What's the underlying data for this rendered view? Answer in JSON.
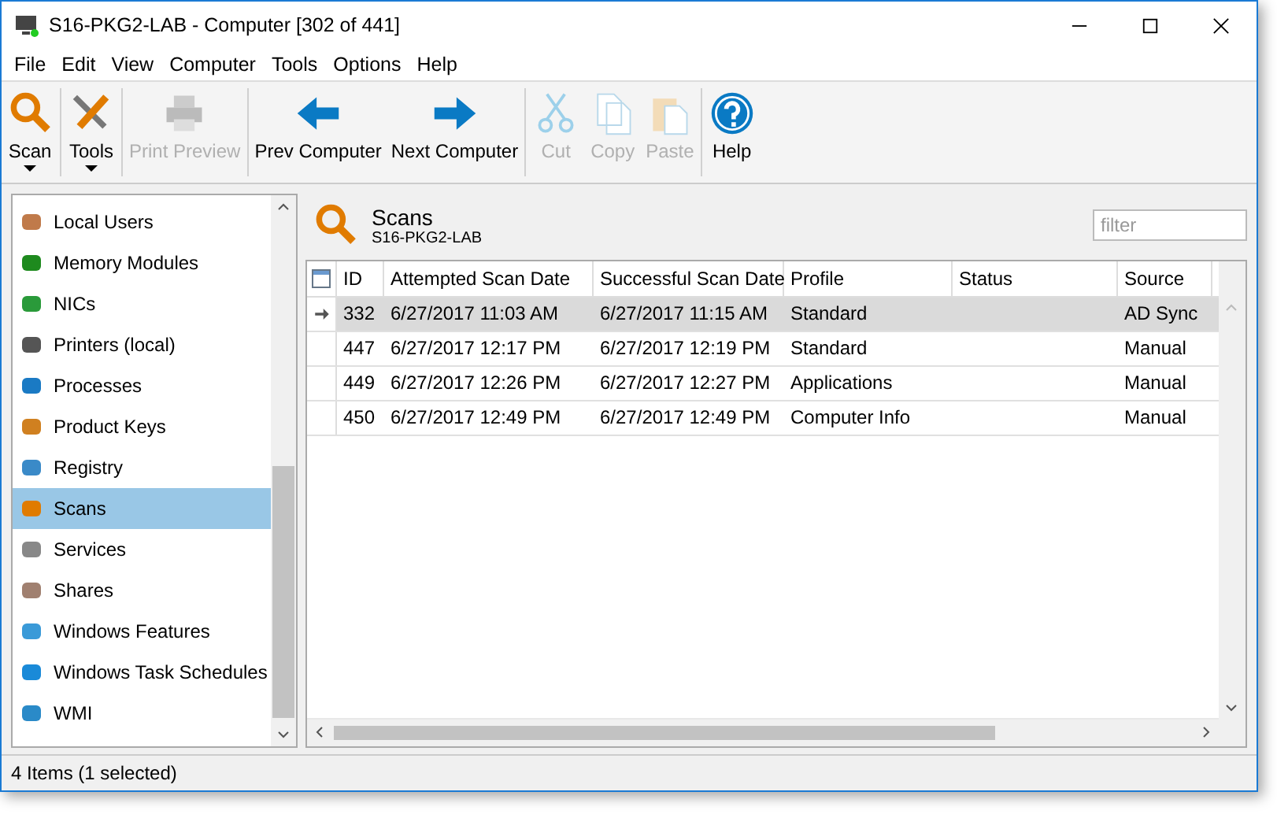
{
  "window": {
    "title": "S16-PKG2-LAB - Computer [302 of 441]"
  },
  "menu": [
    "File",
    "Edit",
    "View",
    "Computer",
    "Tools",
    "Options",
    "Help"
  ],
  "toolbar": [
    {
      "label": "Scan",
      "kind": "dropdown",
      "disabled": false
    },
    {
      "label": "Tools",
      "kind": "dropdown",
      "disabled": false
    },
    {
      "label": "Print Preview",
      "kind": "button",
      "disabled": true
    },
    {
      "label": "Prev Computer",
      "kind": "button",
      "disabled": false
    },
    {
      "label": "Next Computer",
      "kind": "button",
      "disabled": false
    },
    {
      "label": "Cut",
      "kind": "button",
      "disabled": true
    },
    {
      "label": "Copy",
      "kind": "button",
      "disabled": true
    },
    {
      "label": "Paste",
      "kind": "button",
      "disabled": true
    },
    {
      "label": "Help",
      "kind": "button",
      "disabled": false
    }
  ],
  "sidebar": {
    "items": [
      {
        "label": "Local Users",
        "selected": false
      },
      {
        "label": "Memory Modules",
        "selected": false
      },
      {
        "label": "NICs",
        "selected": false
      },
      {
        "label": "Printers (local)",
        "selected": false
      },
      {
        "label": "Processes",
        "selected": false
      },
      {
        "label": "Product Keys",
        "selected": false
      },
      {
        "label": "Registry",
        "selected": false
      },
      {
        "label": "Scans",
        "selected": true
      },
      {
        "label": "Services",
        "selected": false
      },
      {
        "label": "Shares",
        "selected": false
      },
      {
        "label": "Windows Features",
        "selected": false
      },
      {
        "label": "Windows Task Schedules",
        "selected": false
      },
      {
        "label": "WMI",
        "selected": false
      }
    ]
  },
  "panel": {
    "title": "Scans",
    "subtitle": "S16-PKG2-LAB",
    "filter": {
      "placeholder": "filter"
    }
  },
  "table": {
    "columns": [
      "ID",
      "Attempted Scan Date",
      "Successful Scan Date",
      "Profile",
      "Status",
      "Source"
    ],
    "rows": [
      {
        "cells": [
          "332",
          "6/27/2017 11:03 AM",
          "6/27/2017 11:15 AM",
          "Standard",
          "",
          "AD Sync"
        ],
        "selected": true
      },
      {
        "cells": [
          "447",
          "6/27/2017 12:17 PM",
          "6/27/2017 12:19 PM",
          "Standard",
          "",
          "Manual"
        ],
        "selected": false
      },
      {
        "cells": [
          "449",
          "6/27/2017 12:26 PM",
          "6/27/2017 12:27 PM",
          "Applications",
          "",
          "Manual"
        ],
        "selected": false
      },
      {
        "cells": [
          "450",
          "6/27/2017 12:49 PM",
          "6/27/2017 12:49 PM",
          "Computer Info",
          "",
          "Manual"
        ],
        "selected": false
      }
    ]
  },
  "status_bar": "4 Items (1 selected)"
}
